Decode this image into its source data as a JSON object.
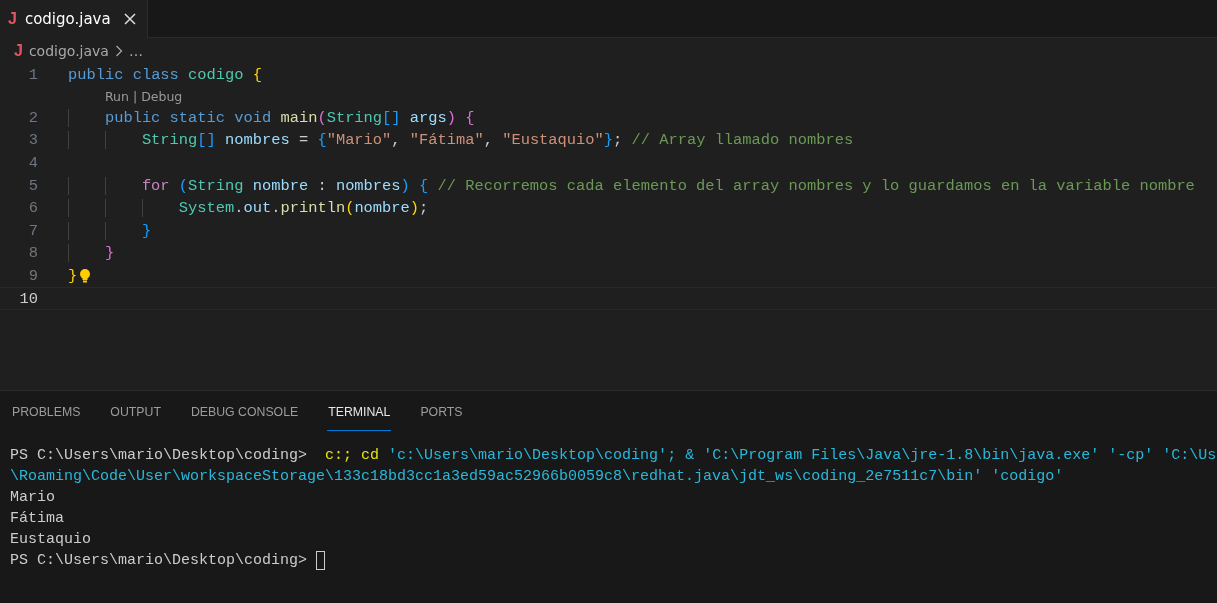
{
  "tabs": [
    {
      "file_icon": "J",
      "label": "codigo.java",
      "selected": true
    }
  ],
  "breadcrumb": {
    "file_icon": "J",
    "file": "codigo.java",
    "more": "…"
  },
  "lines": [
    {
      "number": "1",
      "current": false,
      "lightbulb": false,
      "tokens": [
        {
          "text": "public ",
          "kind": "kw"
        },
        {
          "text": "class ",
          "kind": "kw"
        },
        {
          "text": "codigo ",
          "kind": "type"
        },
        {
          "text": "{",
          "kind": "b1"
        }
      ],
      "code_lens": {
        "items": [
          "Run",
          "Debug"
        ],
        "separator": "|"
      }
    },
    {
      "number": "2",
      "current": false,
      "lightbulb": false,
      "tokens": [
        {
          "text": "    public ",
          "kind": "kw"
        },
        {
          "text": "static ",
          "kind": "kw"
        },
        {
          "text": "void ",
          "kind": "kw"
        },
        {
          "text": "main",
          "kind": "fn"
        },
        {
          "text": "(",
          "kind": "b2"
        },
        {
          "text": "String",
          "kind": "type"
        },
        {
          "text": "[] ",
          "kind": "b3"
        },
        {
          "text": "args",
          "kind": "var"
        },
        {
          "text": ") ",
          "kind": "b2"
        },
        {
          "text": "{",
          "kind": "b2"
        }
      ]
    },
    {
      "number": "3",
      "current": false,
      "lightbulb": false,
      "tokens": [
        {
          "text": "        String",
          "kind": "type"
        },
        {
          "text": "[] ",
          "kind": "b3"
        },
        {
          "text": "nombres ",
          "kind": "var"
        },
        {
          "text": "= ",
          "kind": "plain"
        },
        {
          "text": "{",
          "kind": "b3"
        },
        {
          "text": "\"Mario\"",
          "kind": "str"
        },
        {
          "text": ", ",
          "kind": "plain"
        },
        {
          "text": "\"Fátima\"",
          "kind": "str"
        },
        {
          "text": ", ",
          "kind": "plain"
        },
        {
          "text": "\"Eustaquio\"",
          "kind": "str"
        },
        {
          "text": "}",
          "kind": "b3"
        },
        {
          "text": "; ",
          "kind": "plain"
        },
        {
          "text": "// Array llamado nombres",
          "kind": "cmt"
        }
      ]
    },
    {
      "number": "4",
      "current": false,
      "lightbulb": false
    },
    {
      "number": "5",
      "current": false,
      "lightbulb": false,
      "tokens": [
        {
          "text": "        for ",
          "kind": "ctl"
        },
        {
          "text": "(",
          "kind": "b3"
        },
        {
          "text": "String ",
          "kind": "type"
        },
        {
          "text": "nombre ",
          "kind": "var"
        },
        {
          "text": ": ",
          "kind": "plain"
        },
        {
          "text": "nombres",
          "kind": "var"
        },
        {
          "text": ") ",
          "kind": "b3"
        },
        {
          "text": "{ ",
          "kind": "b3"
        },
        {
          "text": "// Recorremos cada elemento del array nombres y lo guardamos en la variable nombre",
          "kind": "cmt"
        }
      ]
    },
    {
      "number": "6",
      "current": false,
      "lightbulb": false,
      "tokens": [
        {
          "text": "            System",
          "kind": "type"
        },
        {
          "text": ".",
          "kind": "plain"
        },
        {
          "text": "out",
          "kind": "var"
        },
        {
          "text": ".",
          "kind": "plain"
        },
        {
          "text": "println",
          "kind": "fn"
        },
        {
          "text": "(",
          "kind": "b1"
        },
        {
          "text": "nombre",
          "kind": "var"
        },
        {
          "text": ")",
          "kind": "b1"
        },
        {
          "text": ";",
          "kind": "plain"
        }
      ]
    },
    {
      "number": "7",
      "current": false,
      "lightbulb": false,
      "tokens": [
        {
          "text": "        }",
          "kind": "b3"
        }
      ]
    },
    {
      "number": "8",
      "current": false,
      "lightbulb": false,
      "tokens": [
        {
          "text": "    }",
          "kind": "b2"
        }
      ]
    },
    {
      "number": "9",
      "current": false,
      "lightbulb": true,
      "tokens": [
        {
          "text": "}",
          "kind": "b1"
        }
      ]
    },
    {
      "number": "10",
      "current": true,
      "lightbulb": false
    }
  ],
  "panel_tabs": [
    {
      "label": "PROBLEMS",
      "selected": false
    },
    {
      "label": "OUTPUT",
      "selected": false
    },
    {
      "label": "DEBUG CONSOLE",
      "selected": false
    },
    {
      "label": "TERMINAL",
      "selected": true
    },
    {
      "label": "PORTS",
      "selected": false
    }
  ],
  "terminal": {
    "lines": [
      [
        {
          "text": "PS C:\\Users\\mario\\Desktop\\coding>  ",
          "kind": "out"
        },
        {
          "text": "c:; cd",
          "kind": "cmd"
        },
        {
          "text": " 'c:\\Users\\mario\\Desktop\\coding'; & 'C:\\Program Files\\Java\\jre-1.8\\bin\\java.exe' '-cp' 'C:\\Us",
          "kind": "arg"
        }
      ],
      [
        {
          "text": "\\Roaming\\Code\\User\\workspaceStorage\\133c18bd3cc1a3ed59ac52966b0059c8\\redhat.java\\jdt_ws\\coding_2e7511c7\\bin' 'codigo'",
          "kind": "arg"
        }
      ],
      [
        {
          "text": "Mario",
          "kind": "out"
        }
      ],
      [
        {
          "text": "Fátima",
          "kind": "out"
        }
      ],
      [
        {
          "text": "Eustaquio",
          "kind": "out"
        }
      ],
      [
        {
          "text": "PS C:\\Users\\mario\\Desktop\\coding> ",
          "kind": "out"
        }
      ]
    ],
    "cursor": true
  }
}
